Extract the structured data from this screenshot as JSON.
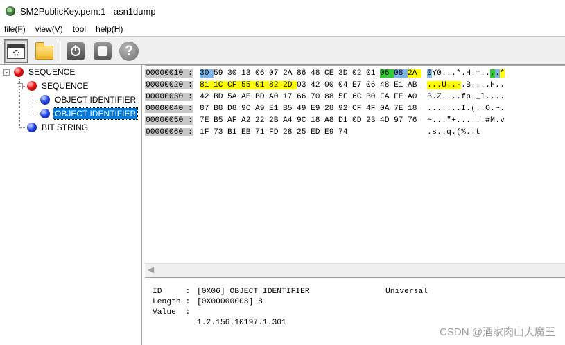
{
  "window": {
    "title": "SM2PublicKey.pem:1 - asn1dump"
  },
  "menu": [
    {
      "text": "file(",
      "key": "F",
      "end": ")"
    },
    {
      "text": "view(",
      "key": "V",
      "end": ")"
    },
    {
      "text": "tool",
      "key": "",
      "end": ""
    },
    {
      "text": "help(",
      "key": "H",
      "end": ")"
    }
  ],
  "toolbar": [
    "settings-icon",
    "folder-icon",
    "power-icon",
    "disk-icon",
    "help-icon"
  ],
  "tree": [
    {
      "label": "SEQUENCE",
      "color": "red",
      "toggle": "-"
    },
    {
      "label": "SEQUENCE",
      "color": "red",
      "toggle": "-"
    },
    {
      "label": "OBJECT IDENTIFIER",
      "color": "blue",
      "toggle": ""
    },
    {
      "label": "OBJECT IDENTIFIER",
      "color": "blue",
      "toggle": "",
      "selected": true
    },
    {
      "label": "BIT STRING",
      "color": "blue",
      "toggle": ""
    }
  ],
  "hex": {
    "sep": ":",
    "highlight_colors": {
      "y": "#ffff00",
      "b": "#7fb7ec",
      "g": "#33cc33"
    },
    "rows": [
      {
        "addr": "00000010",
        "bytes": [
          "30",
          "59",
          "30",
          "13",
          "06",
          "07",
          "2A",
          "86",
          "48",
          "CE",
          "3D",
          "02",
          "01",
          "06",
          "08",
          "2A"
        ],
        "hl": [
          "b",
          "",
          "",
          "",
          "",
          "",
          "",
          "",
          "",
          "",
          "",
          "",
          "",
          "g",
          "b",
          "y"
        ],
        "ascii": [
          "0",
          "Y",
          "0",
          ".",
          ".",
          ".",
          "*",
          ".",
          "H",
          ".",
          "=",
          ".",
          ".",
          ".",
          ".",
          "*"
        ],
        "ahl": [
          "b",
          "",
          "",
          "",
          "",
          "",
          "",
          "",
          "",
          "",
          "",
          "",
          "",
          "g",
          "b",
          "y"
        ]
      },
      {
        "addr": "00000020",
        "bytes": [
          "81",
          "1C",
          "CF",
          "55",
          "01",
          "82",
          "2D",
          "03",
          "42",
          "00",
          "04",
          "E7",
          "06",
          "48",
          "E1",
          "AB"
        ],
        "hl": [
          "y",
          "y",
          "y",
          "y",
          "y",
          "y",
          "y",
          "",
          "",
          "",
          "",
          "",
          "",
          "",
          "",
          ""
        ],
        "ascii": [
          ".",
          ".",
          ".",
          "U",
          ".",
          ".",
          "-",
          ".",
          "B",
          ".",
          ".",
          ".",
          ".",
          "H",
          ".",
          "."
        ],
        "ahl": [
          "y",
          "y",
          "y",
          "y",
          "y",
          "y",
          "y",
          "",
          "",
          "",
          "",
          "",
          "",
          "",
          "",
          ""
        ]
      },
      {
        "addr": "00000030",
        "bytes": [
          "42",
          "BD",
          "5A",
          "AE",
          "BD",
          "A0",
          "17",
          "66",
          "70",
          "88",
          "5F",
          "6C",
          "B0",
          "FA",
          "FE",
          "A0"
        ],
        "hl": [],
        "ascii": [
          "B",
          ".",
          "Z",
          ".",
          ".",
          ".",
          ".",
          "f",
          "p",
          ".",
          "_",
          "l",
          ".",
          ".",
          ".",
          "."
        ],
        "ahl": []
      },
      {
        "addr": "00000040",
        "bytes": [
          "87",
          "B8",
          "D8",
          "9C",
          "A9",
          "E1",
          "B5",
          "49",
          "E9",
          "28",
          "92",
          "CF",
          "4F",
          "0A",
          "7E",
          "18"
        ],
        "hl": [],
        "ascii": [
          ".",
          ".",
          ".",
          ".",
          ".",
          ".",
          ".",
          "I",
          ".",
          "(",
          ".",
          ".",
          "O",
          ".",
          "~",
          "."
        ],
        "ahl": []
      },
      {
        "addr": "00000050",
        "bytes": [
          "7E",
          "B5",
          "AF",
          "A2",
          "22",
          "2B",
          "A4",
          "9C",
          "18",
          "A8",
          "D1",
          "0D",
          "23",
          "4D",
          "97",
          "76"
        ],
        "hl": [],
        "ascii": [
          "~",
          ".",
          ".",
          ".",
          "\"",
          "+",
          ".",
          ".",
          ".",
          ".",
          ".",
          ".",
          "#",
          "M",
          ".",
          "v"
        ],
        "ahl": []
      },
      {
        "addr": "00000060",
        "bytes": [
          "1F",
          "73",
          "B1",
          "EB",
          "71",
          "FD",
          "28",
          "25",
          "ED",
          "E9",
          "74"
        ],
        "hl": [],
        "ascii": [
          ".",
          "s",
          ".",
          ".",
          "q",
          ".",
          "(",
          "%",
          ".",
          ".",
          "t"
        ],
        "ahl": []
      }
    ]
  },
  "info": {
    "id_label": "ID     :",
    "id_value": "[0X06] OBJECT IDENTIFIER",
    "class_value": "Universal",
    "length_label": "Length :",
    "length_value": "[0X00000008] 8",
    "value_label": "Value  :",
    "value_text": "1.2.156.10197.1.301"
  },
  "watermark": "CSDN @酒家肉山大魔王"
}
